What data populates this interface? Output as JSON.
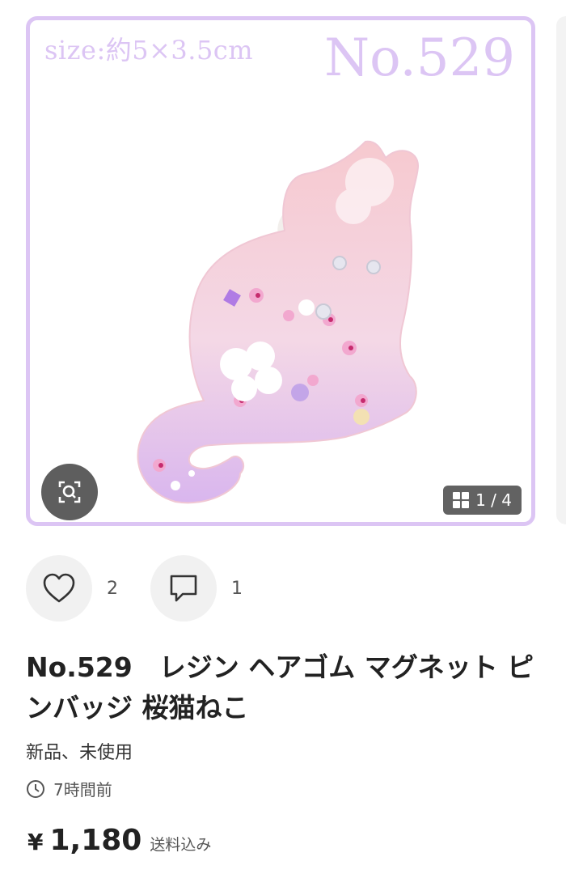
{
  "image": {
    "size_label": "size:約5×3.5cm",
    "product_number": "No.529",
    "page_counter": "1 / 4",
    "colors": {
      "frame": "#dcc5f4",
      "badge": "#5e5e5e"
    },
    "icons": {
      "lens": "image-search-icon",
      "gallery": "grid-icon"
    }
  },
  "actions": {
    "like": {
      "icon": "heart-icon",
      "count": "2"
    },
    "comment": {
      "icon": "comment-icon",
      "count": "1"
    }
  },
  "item": {
    "title": "No.529　レジン ヘアゴム マグネット ピンバッジ 桜猫ねこ",
    "condition": "新品、未使用",
    "posted": "7時間前",
    "currency": "¥",
    "price": "1,180",
    "shipping": "送料込み"
  }
}
